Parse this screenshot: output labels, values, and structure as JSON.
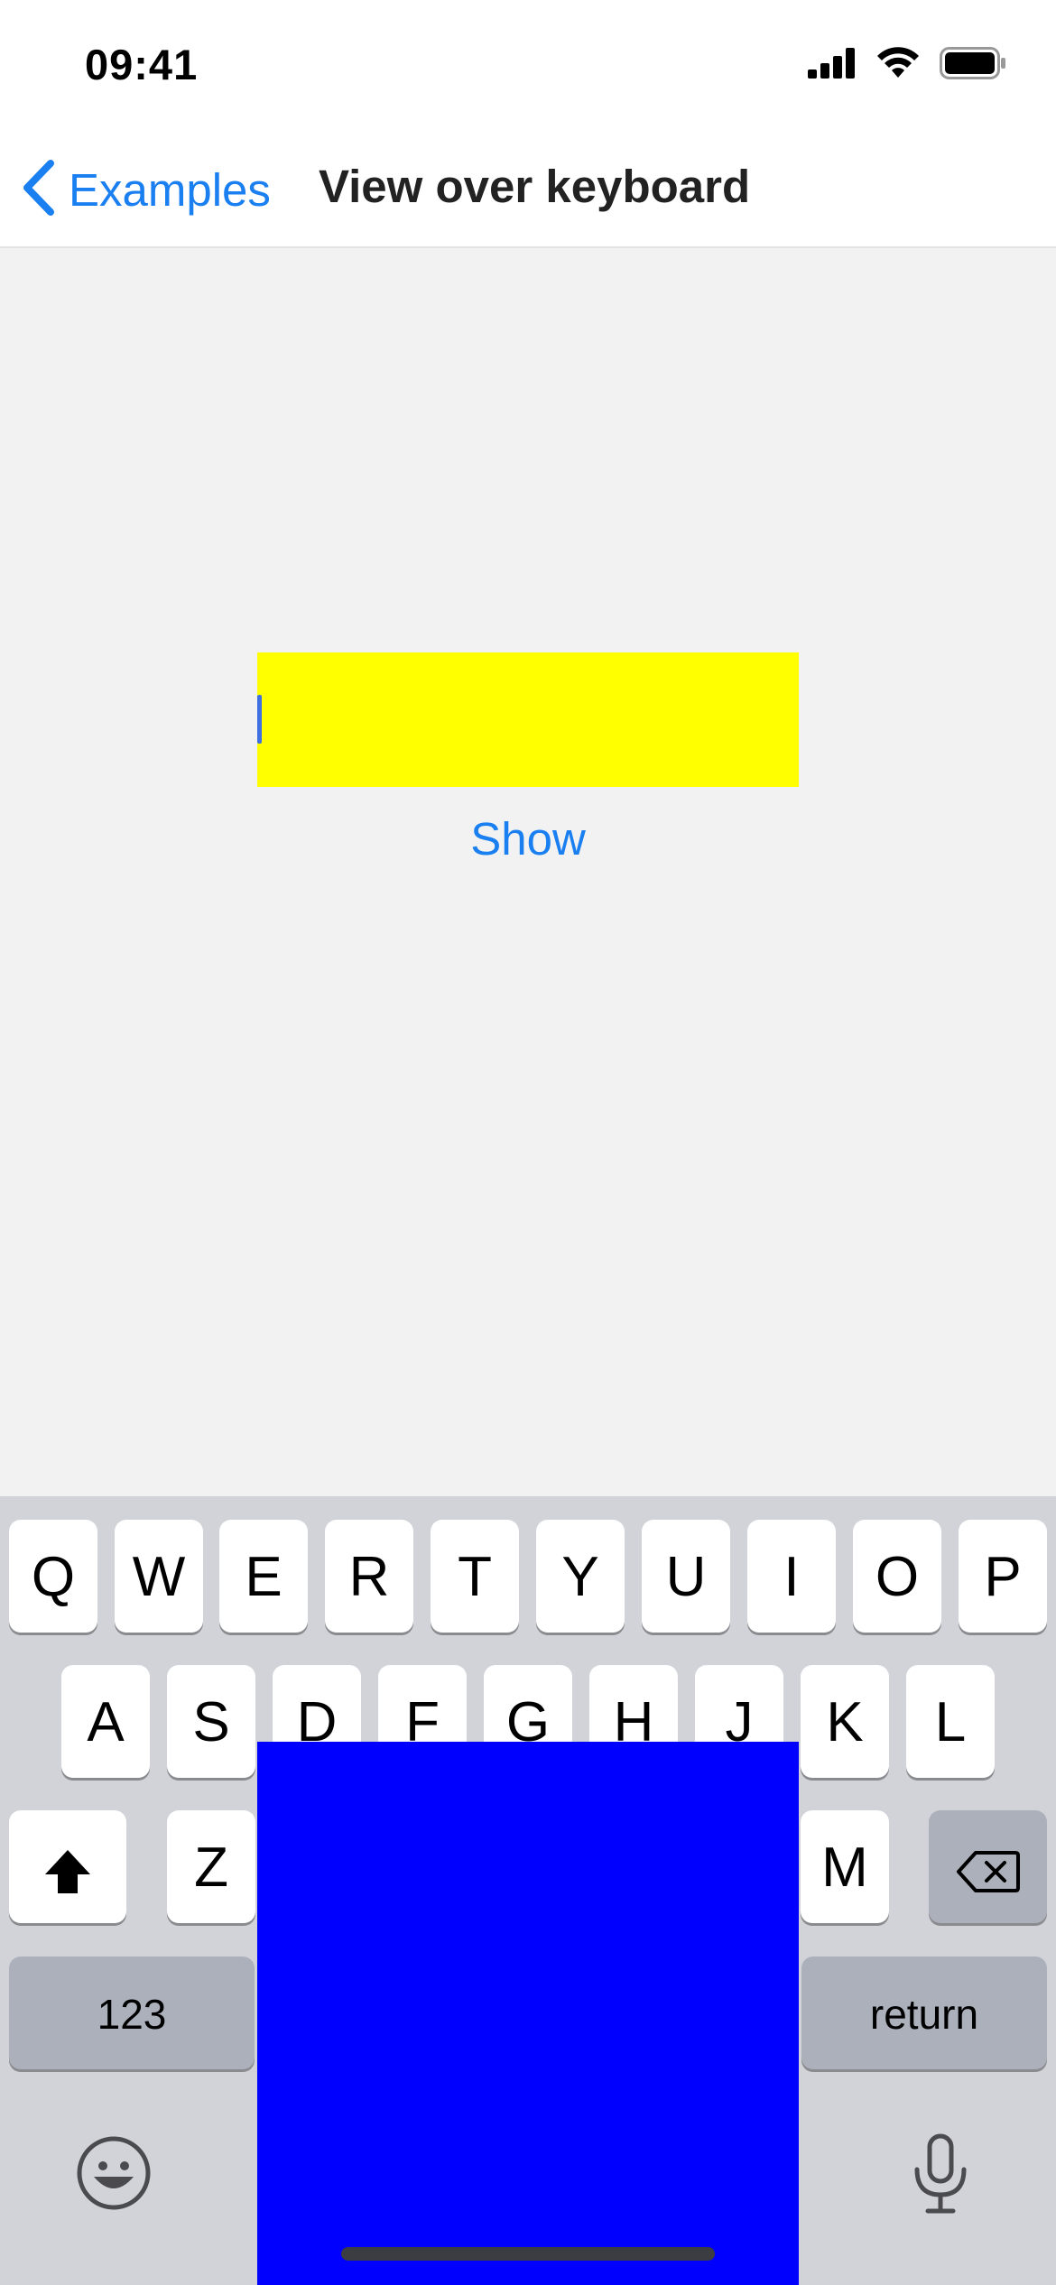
{
  "status_bar": {
    "time": "09:41",
    "icons": [
      "cellular-signal-icon",
      "wifi-icon",
      "battery-icon"
    ]
  },
  "nav": {
    "back_label": "Examples",
    "title": "View over keyboard"
  },
  "content": {
    "text_field_value": "",
    "text_field_color": "#ffff00",
    "show_button_label": "Show",
    "overlay_color": "#0000ff"
  },
  "keyboard": {
    "row1": [
      "Q",
      "W",
      "E",
      "R",
      "T",
      "Y",
      "U",
      "I",
      "O",
      "P"
    ],
    "row2": [
      "A",
      "S",
      "D",
      "F",
      "G",
      "H",
      "J",
      "K",
      "L"
    ],
    "row3": [
      "Z",
      "M"
    ],
    "numbers_label": "123",
    "return_label": "return",
    "icons": [
      "shift-icon",
      "backspace-icon",
      "emoji-icon",
      "microphone-icon"
    ]
  },
  "colors": {
    "accent": "#1a7ff0",
    "keyboard_background": "#d1d3d9",
    "key_background": "#ffffff",
    "function_key_background": "#acb0ba"
  }
}
